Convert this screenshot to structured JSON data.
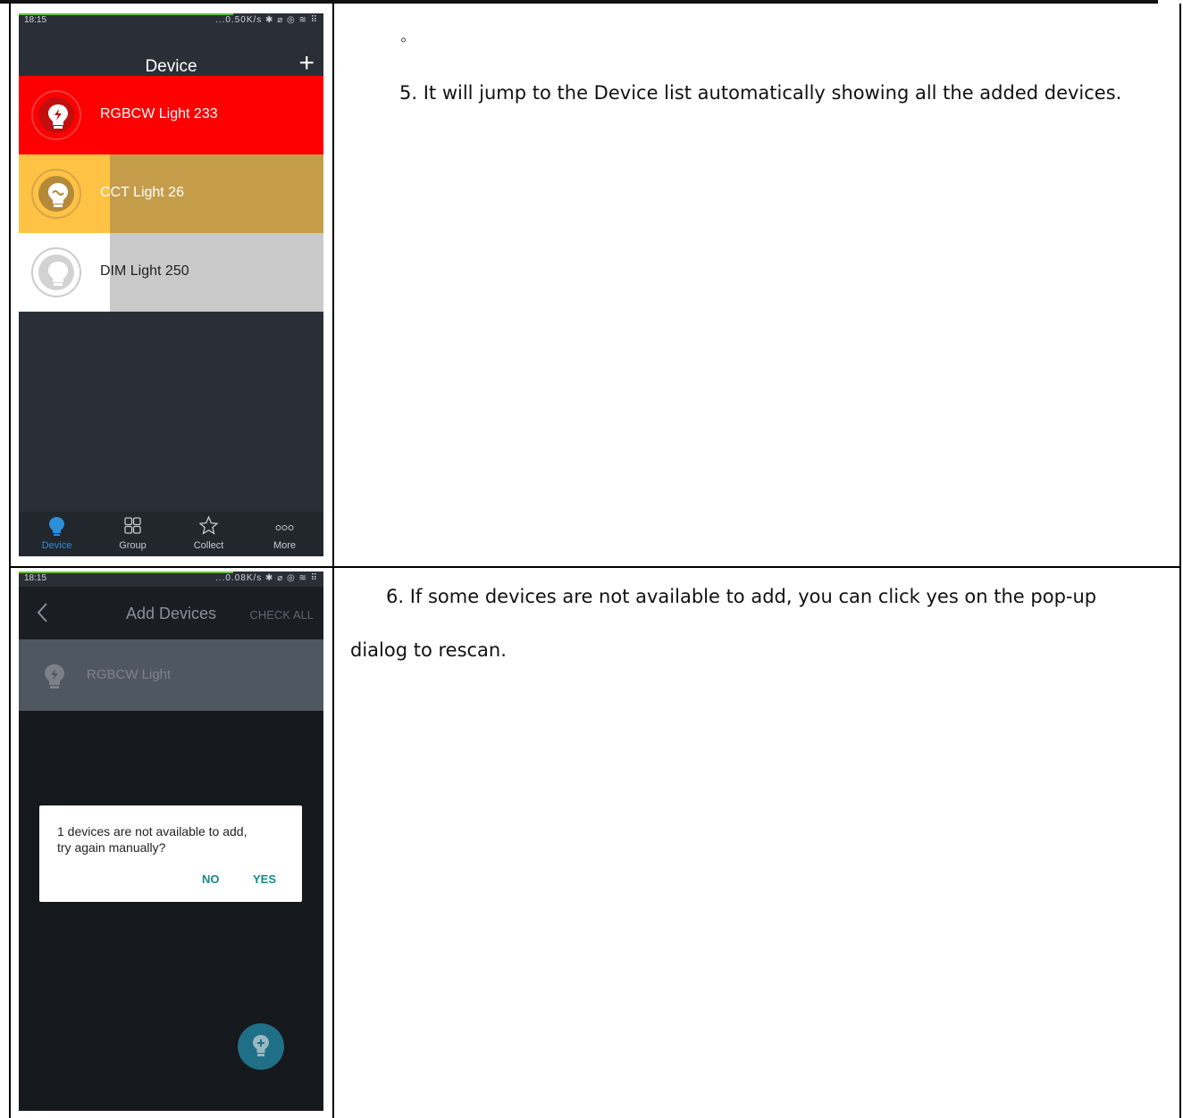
{
  "doc": {
    "bullet": "◦",
    "step5": "5. It will jump to the Device list automatically showing all the added devices.",
    "step6_line1": "6. If some devices are not available to add, you can click yes on the pop-up",
    "step6_line2": "dialog to rescan."
  },
  "screen1": {
    "status": {
      "time": "18:15",
      "right": "...0.50K/s ✱ ⌀ ◎ ≋ ⠿"
    },
    "header": {
      "title": "Device"
    },
    "devices": [
      {
        "name": "RGBCW Light 233",
        "bg": "#fe0000",
        "text_color": "#ffffff",
        "ring": "#e83b3b",
        "icon_bg": "#c10f0f"
      },
      {
        "name": "CCT Light 26",
        "bg": "#c59d4a",
        "left_bg": "#fec244",
        "text_color": "#ffffff",
        "ring": "#d8a54a",
        "icon_bg": "#b5893a"
      },
      {
        "name": "DIM Light 250",
        "bg": "#c9c9c9",
        "left_bg": "#ffffff",
        "text_color": "#222222",
        "ring": "#cccccc",
        "icon_bg": "#d2d2d2"
      }
    ],
    "tabs": [
      {
        "label": "Device",
        "icon": "bulb-icon",
        "active": true
      },
      {
        "label": "Group",
        "icon": "grid-icon",
        "active": false
      },
      {
        "label": "Collect",
        "icon": "star-icon",
        "active": false
      },
      {
        "label": "More",
        "icon": "more-icon",
        "active": false
      }
    ],
    "accent": "#2d8fd8"
  },
  "screen2": {
    "status": {
      "time": "18:15",
      "right": "...0.08K/s ✱ ⌀ ◎ ≋ ⠿"
    },
    "header": {
      "title": "Add Devices",
      "check_all": "CHECK ALL"
    },
    "device": {
      "name": "RGBCW Light"
    },
    "dialog": {
      "message_line1": "1 devices are not available to add,",
      "message_line2": "try again manually?",
      "no": "NO",
      "yes": "YES"
    }
  }
}
